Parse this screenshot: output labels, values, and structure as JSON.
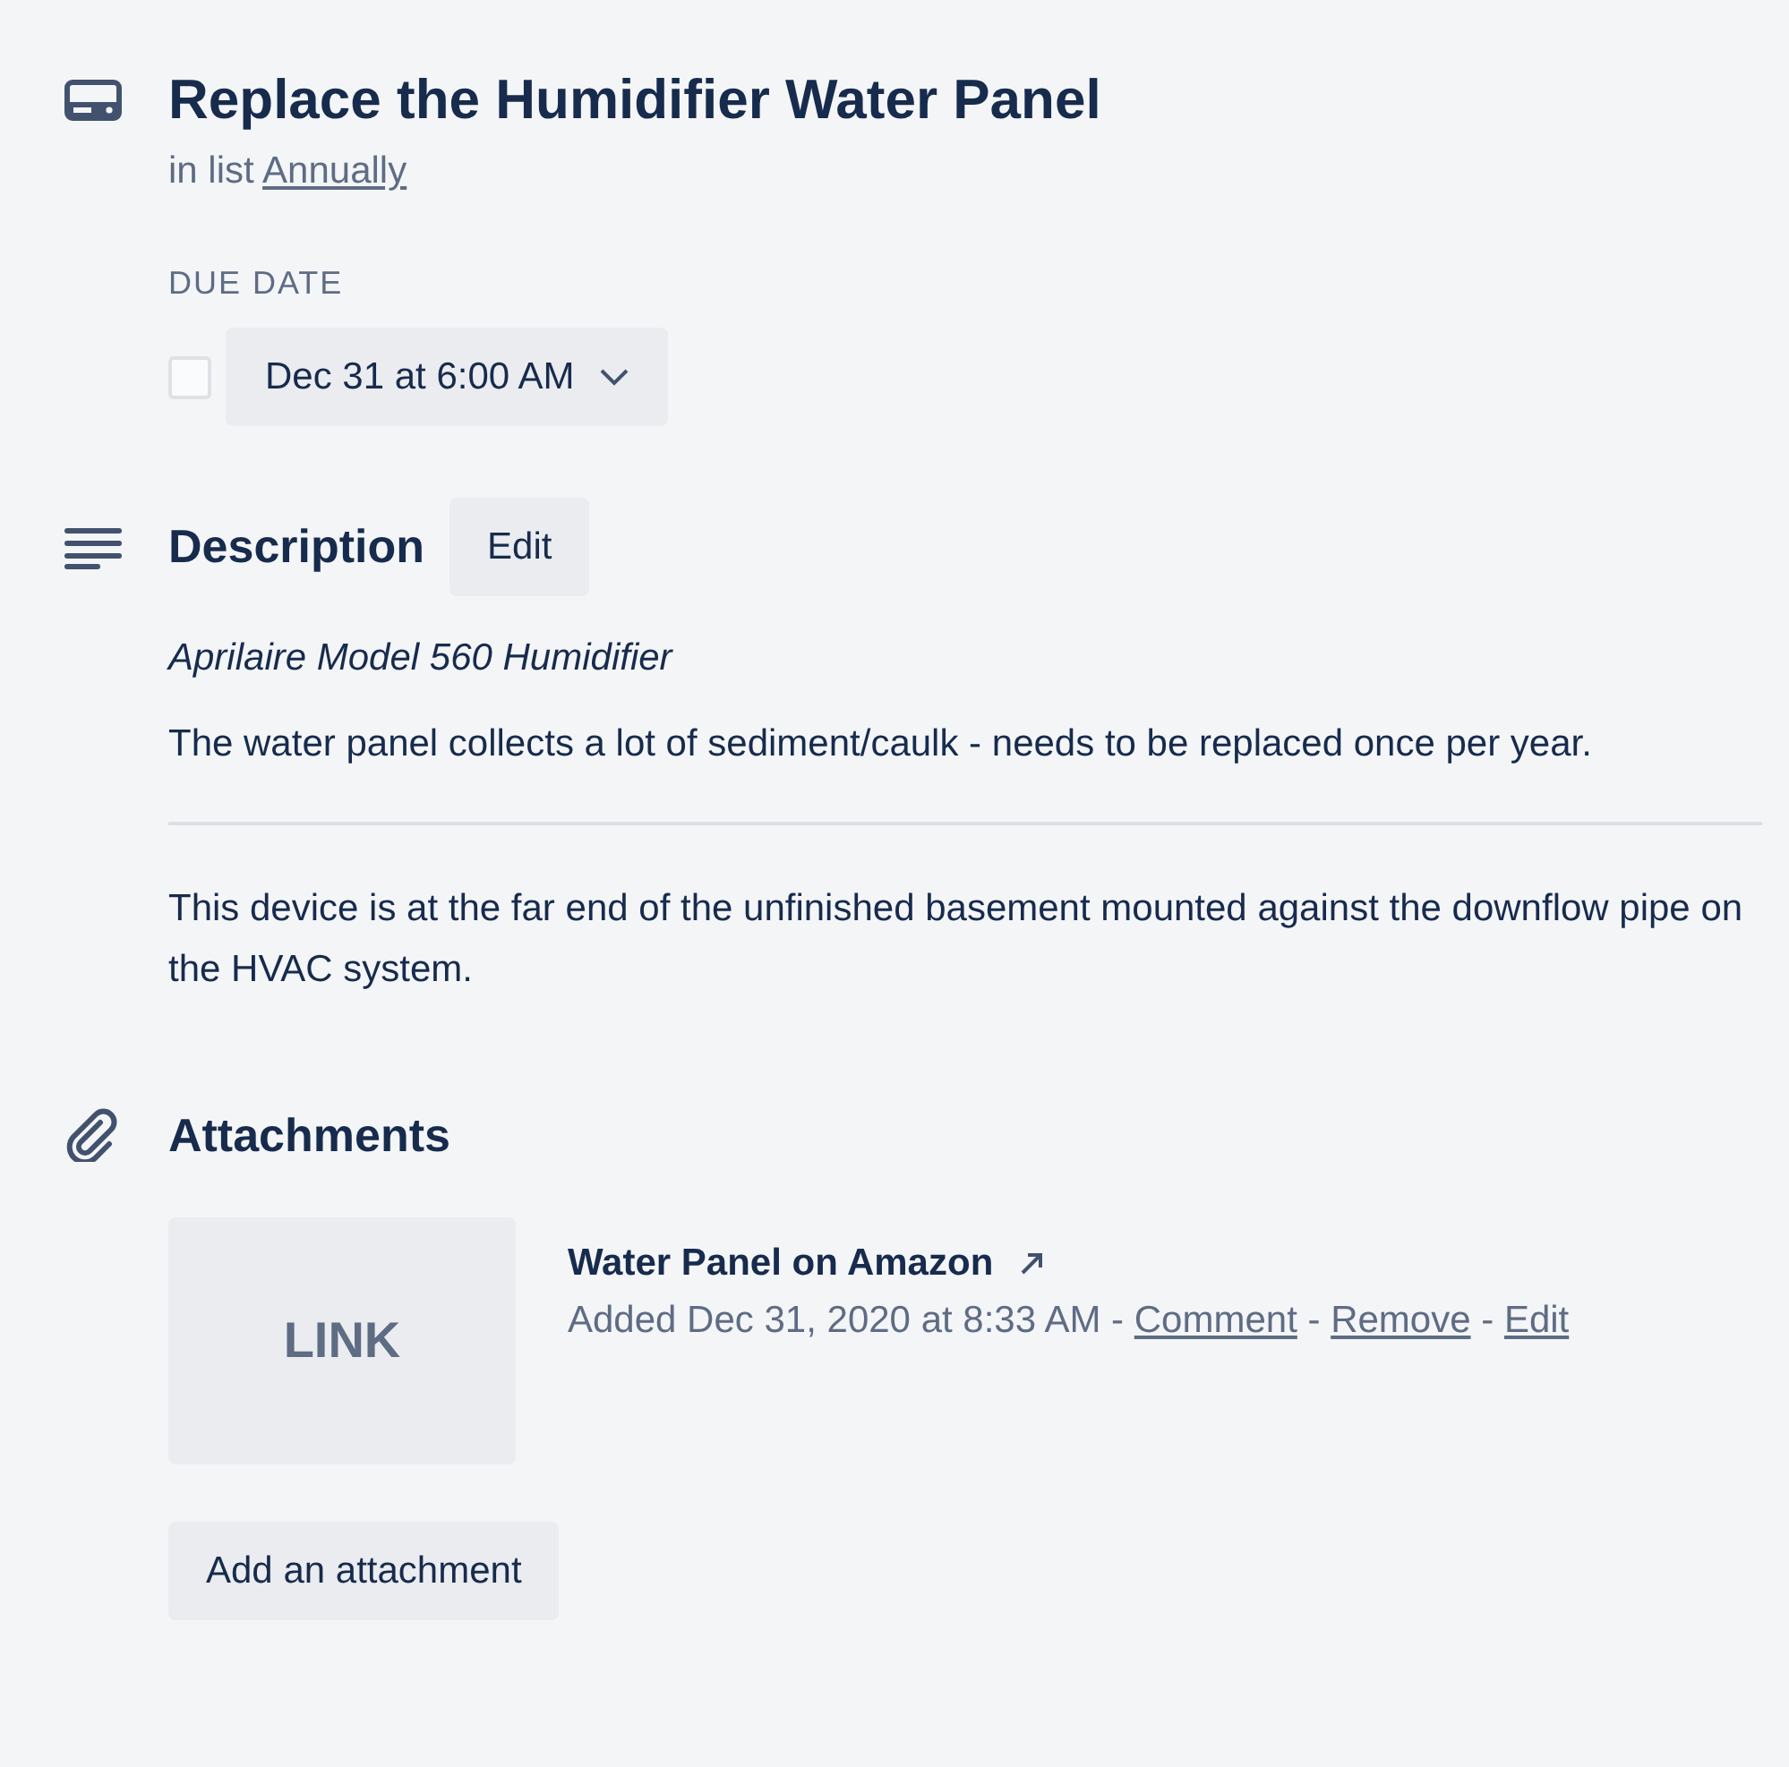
{
  "card": {
    "title": "Replace the Humidifier Water Panel",
    "list_prefix": "in list",
    "list_name": "Annually"
  },
  "due_date": {
    "label": "DUE DATE",
    "checked": false,
    "value": "Dec 31 at 6:00 AM"
  },
  "description": {
    "heading": "Description",
    "edit_button": "Edit",
    "blocks": [
      {
        "kind": "italic",
        "text": "Aprilaire Model 560 Humidifier"
      },
      {
        "kind": "plain",
        "text": "The water panel collects a lot of sediment/caulk - needs to be replaced once per year."
      },
      {
        "kind": "divider"
      },
      {
        "kind": "plain",
        "text": "This device is at the far end of the unfinished basement mounted against the downflow pipe on the HVAC system."
      }
    ]
  },
  "attachments": {
    "heading": "Attachments",
    "items": [
      {
        "thumbnail": "LINK",
        "title": "Water Panel on Amazon",
        "added": "Added Dec 31, 2020 at 8:33 AM",
        "separator": "-",
        "actions": [
          "Comment",
          "Remove",
          "Edit"
        ]
      }
    ],
    "add_button": "Add an attachment"
  }
}
